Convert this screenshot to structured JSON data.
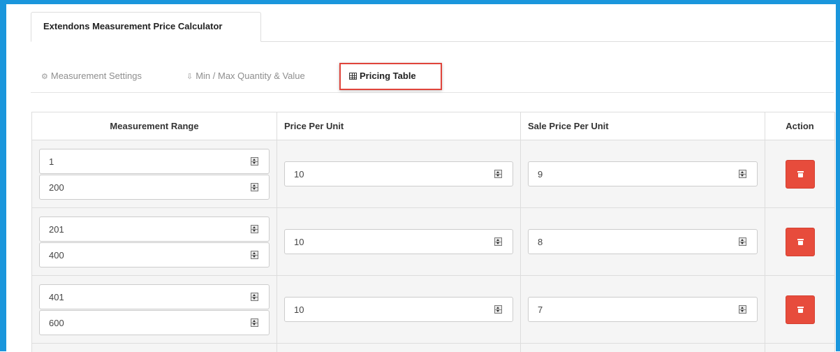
{
  "main_tab": {
    "label": "Extendons Measurement Price Calculator"
  },
  "subtabs": [
    {
      "label": "Measurement Settings",
      "icon": "gears-icon",
      "active": false
    },
    {
      "label": "Min / Max Quantity & Value",
      "icon": "sort-amount-icon",
      "active": false
    },
    {
      "label": "Pricing Table",
      "icon": "table-icon",
      "active": true
    }
  ],
  "table": {
    "headers": {
      "range": "Measurement Range",
      "price": "Price Per Unit",
      "sale": "Sale Price Per Unit",
      "action": "Action"
    },
    "rows": [
      {
        "min": "1",
        "max": "200",
        "price": "10",
        "sale": "9"
      },
      {
        "min": "201",
        "max": "400",
        "price": "10",
        "sale": "8"
      },
      {
        "min": "401",
        "max": "600",
        "price": "10",
        "sale": "7"
      }
    ]
  },
  "colors": {
    "frame": "#1a96dc",
    "highlight": "#e0443b",
    "delete_button": "#e74c3c"
  }
}
